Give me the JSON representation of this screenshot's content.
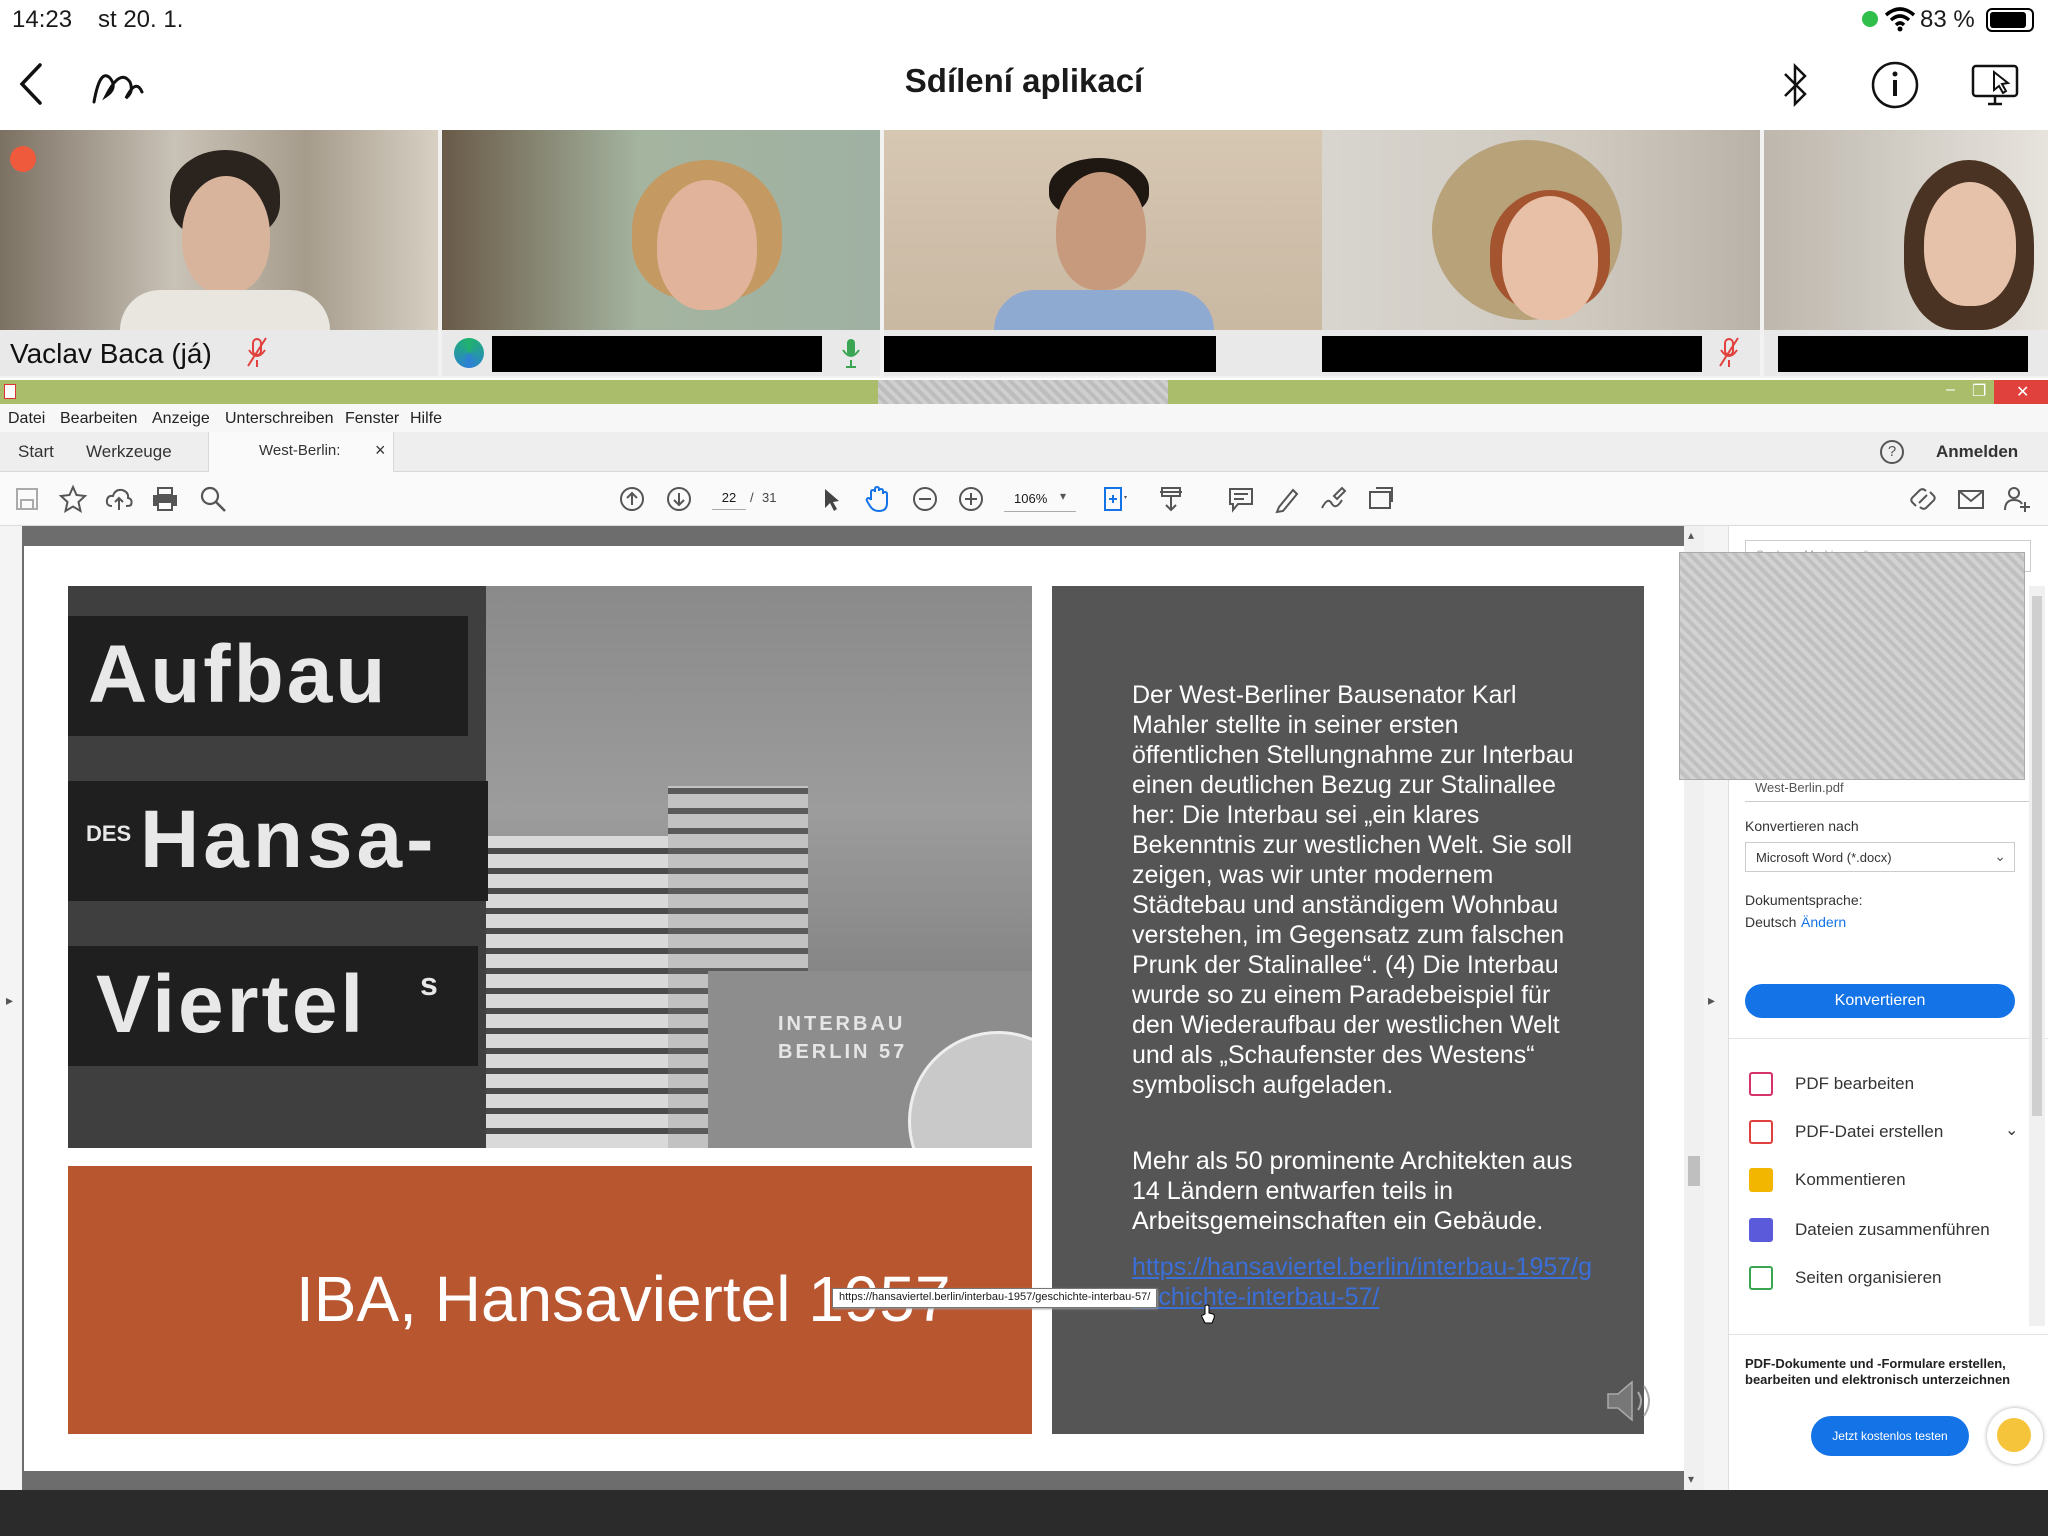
{
  "status_bar": {
    "time": "14:23",
    "date": "st 20. 1.",
    "battery": "83 %",
    "icons": [
      "green-dot",
      "wifi-icon",
      "battery-icon"
    ]
  },
  "app_header": {
    "title": "Sdílení aplikací",
    "left_icons": [
      "back-icon",
      "scribble-icon"
    ],
    "right_icons": [
      "bluetooth-icon",
      "info-icon",
      "screen-share-icon"
    ]
  },
  "participants": [
    {
      "name": "Vaclav Baca (já)",
      "mic": "muted"
    },
    {
      "name": "",
      "mic": "active"
    },
    {
      "name": "",
      "mic": "none"
    },
    {
      "name": "",
      "mic": "muted"
    },
    {
      "name": "",
      "mic": "muted"
    }
  ],
  "acrobat": {
    "menu": [
      "Datei",
      "Bearbeiten",
      "Anzeige",
      "Unterschreiben",
      "Fenster",
      "Hilfe"
    ],
    "tabs": [
      "Start",
      "Werkzeuge",
      "West-Berlin:"
    ],
    "tab_close": "×",
    "help": "?",
    "signin": "Anmelden",
    "page_current": "22",
    "page_sep": "/",
    "page_total": "31",
    "zoom": "106%",
    "window_controls": [
      "–",
      "❐",
      "✕"
    ]
  },
  "slide": {
    "sign_lines": [
      "Aufbau",
      "DES",
      "Hansa-",
      "Viertel",
      "s"
    ],
    "board_lines": [
      "INTERBAU",
      "BERLIN 57"
    ],
    "caption": "IBA, Hansaviertel 1957",
    "paragraph1": "Der West-Berliner Bausenator Karl Mahler stellte in seiner ersten öffentlichen Stellungnahme zur Interbau einen deutlichen Bezug zur Stalinallee her: Die Interbau sei „ein klares Bekenntnis zur westlichen Welt. Sie soll zeigen, was wir unter modernem Städtebau und anständigem Wohnbau verstehen, im Gegensatz zum falschen Prunk der Stalinallee“. (4) Die Interbau wurde so zu einem Paradebeispiel für den Wiederaufbau der westlichen Welt und als „Schaufenster des Westens“ symbolisch aufgeladen.",
    "paragraph2": "Mehr als 50 prominente Architekten aus 14 Ländern entwarfen teils in Arbeitsgemeinschaften ein Gebäude.",
    "link": "https://hansaviertel.berlin/interbau-1957/geschichte-interbau-57/",
    "tooltip": "https://hansaviertel.berlin/interbau-1957/geschichte-interbau-57/"
  },
  "right_panel": {
    "search_placeholder": "Suchen „Markierung“",
    "file_name": "West-Berlin.pdf",
    "convert_to_label": "Konvertieren nach",
    "convert_to_value": "Microsoft Word (*.docx)",
    "doc_lang_label": "Dokumentsprache:",
    "doc_lang_value": "Deutsch",
    "doc_lang_change": "Ändern",
    "convert_button": "Konvertieren",
    "tools": [
      {
        "label": "PDF bearbeiten",
        "color": "#d6336c"
      },
      {
        "label": "PDF-Datei erstellen",
        "color": "#e0413c"
      },
      {
        "label": "Kommentieren",
        "color": "#f2b600"
      },
      {
        "label": "Dateien zusammenführen",
        "color": "#5a5adb"
      },
      {
        "label": "Seiten organisieren",
        "color": "#3aa653"
      }
    ],
    "promo_text": "PDF-Dokumente und -Formulare erstellen, bearbeiten und elektronisch unterzeichnen",
    "promo_button": "Jetzt kostenlos testen"
  },
  "colors": {
    "accent_blue": "#1473e6",
    "window_green": "#a9bd6b",
    "slide_orange": "#b85630",
    "slide_grey": "#555555"
  }
}
